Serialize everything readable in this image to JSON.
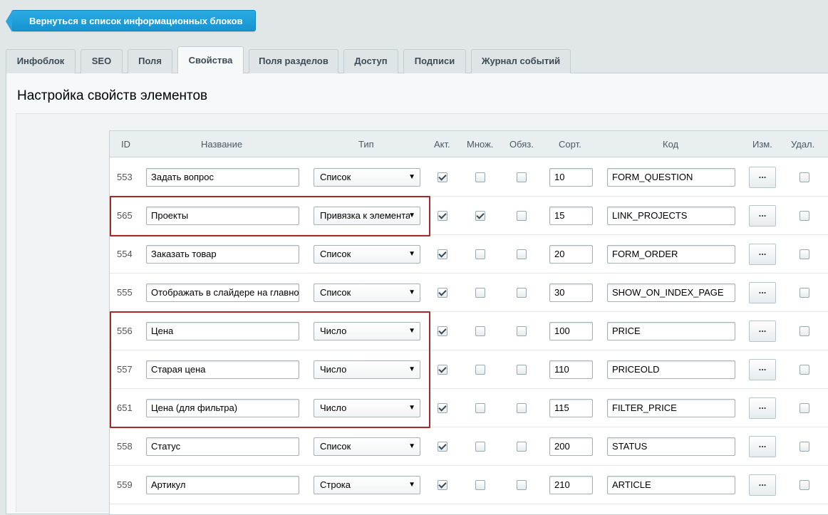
{
  "back_button": "Вернуться в список информационных блоков",
  "tabs": [
    {
      "label": "Инфоблок",
      "active": false
    },
    {
      "label": "SEO",
      "active": false
    },
    {
      "label": "Поля",
      "active": false
    },
    {
      "label": "Свойства",
      "active": true
    },
    {
      "label": "Поля разделов",
      "active": false
    },
    {
      "label": "Доступ",
      "active": false
    },
    {
      "label": "Подписи",
      "active": false
    },
    {
      "label": "Журнал событий",
      "active": false
    }
  ],
  "page_title": "Настройка свойств элементов",
  "table": {
    "headers": {
      "id": "ID",
      "name": "Название",
      "type": "Тип",
      "active": "Акт.",
      "multiple": "Множ.",
      "required": "Обяз.",
      "sort": "Сорт.",
      "code": "Код",
      "edit": "Изм.",
      "delete": "Удал."
    },
    "edit_label": "...",
    "rows": [
      {
        "id": "553",
        "name": "Задать вопрос",
        "type": "Список",
        "active": true,
        "multiple": false,
        "required": false,
        "sort": "10",
        "code": "FORM_QUESTION",
        "delete": false
      },
      {
        "id": "565",
        "name": "Проекты",
        "type": "Привязка к элементам",
        "active": true,
        "multiple": true,
        "required": false,
        "sort": "15",
        "code": "LINK_PROJECTS",
        "delete": false
      },
      {
        "id": "554",
        "name": "Заказать товар",
        "type": "Список",
        "active": true,
        "multiple": false,
        "required": false,
        "sort": "20",
        "code": "FORM_ORDER",
        "delete": false
      },
      {
        "id": "555",
        "name": "Отображать в слайдере на главной",
        "type": "Список",
        "active": true,
        "multiple": false,
        "required": false,
        "sort": "30",
        "code": "SHOW_ON_INDEX_PAGE",
        "delete": false
      },
      {
        "id": "556",
        "name": "Цена",
        "type": "Число",
        "active": true,
        "multiple": false,
        "required": false,
        "sort": "100",
        "code": "PRICE",
        "delete": false
      },
      {
        "id": "557",
        "name": "Старая цена",
        "type": "Число",
        "active": true,
        "multiple": false,
        "required": false,
        "sort": "110",
        "code": "PRICEOLD",
        "delete": false
      },
      {
        "id": "651",
        "name": "Цена (для фильтра)",
        "type": "Число",
        "active": true,
        "multiple": false,
        "required": false,
        "sort": "115",
        "code": "FILTER_PRICE",
        "delete": false
      },
      {
        "id": "558",
        "name": "Статус",
        "type": "Список",
        "active": true,
        "multiple": false,
        "required": false,
        "sort": "200",
        "code": "STATUS",
        "delete": false
      },
      {
        "id": "559",
        "name": "Артикул",
        "type": "Строка",
        "active": true,
        "multiple": false,
        "required": false,
        "sort": "210",
        "code": "ARTICLE",
        "delete": false
      }
    ]
  },
  "colors": {
    "accent": "#1e9cd8",
    "highlight": "#a52a2a"
  },
  "icons": {
    "select_arrow": "triangle-down-icon",
    "checkbox_check": "check-icon"
  }
}
